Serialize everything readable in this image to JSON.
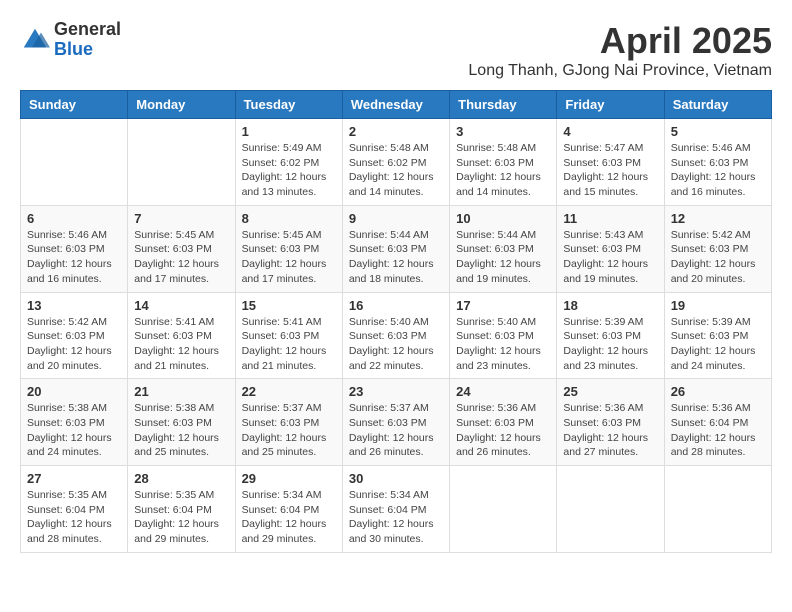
{
  "header": {
    "logo_general": "General",
    "logo_blue": "Blue",
    "month_title": "April 2025",
    "location": "Long Thanh, GJong Nai Province, Vietnam"
  },
  "weekdays": [
    "Sunday",
    "Monday",
    "Tuesday",
    "Wednesday",
    "Thursday",
    "Friday",
    "Saturday"
  ],
  "weeks": [
    [
      {
        "day": "",
        "info": ""
      },
      {
        "day": "",
        "info": ""
      },
      {
        "day": "1",
        "info": "Sunrise: 5:49 AM\nSunset: 6:02 PM\nDaylight: 12 hours and 13 minutes."
      },
      {
        "day": "2",
        "info": "Sunrise: 5:48 AM\nSunset: 6:02 PM\nDaylight: 12 hours and 14 minutes."
      },
      {
        "day": "3",
        "info": "Sunrise: 5:48 AM\nSunset: 6:03 PM\nDaylight: 12 hours and 14 minutes."
      },
      {
        "day": "4",
        "info": "Sunrise: 5:47 AM\nSunset: 6:03 PM\nDaylight: 12 hours and 15 minutes."
      },
      {
        "day": "5",
        "info": "Sunrise: 5:46 AM\nSunset: 6:03 PM\nDaylight: 12 hours and 16 minutes."
      }
    ],
    [
      {
        "day": "6",
        "info": "Sunrise: 5:46 AM\nSunset: 6:03 PM\nDaylight: 12 hours and 16 minutes."
      },
      {
        "day": "7",
        "info": "Sunrise: 5:45 AM\nSunset: 6:03 PM\nDaylight: 12 hours and 17 minutes."
      },
      {
        "day": "8",
        "info": "Sunrise: 5:45 AM\nSunset: 6:03 PM\nDaylight: 12 hours and 17 minutes."
      },
      {
        "day": "9",
        "info": "Sunrise: 5:44 AM\nSunset: 6:03 PM\nDaylight: 12 hours and 18 minutes."
      },
      {
        "day": "10",
        "info": "Sunrise: 5:44 AM\nSunset: 6:03 PM\nDaylight: 12 hours and 19 minutes."
      },
      {
        "day": "11",
        "info": "Sunrise: 5:43 AM\nSunset: 6:03 PM\nDaylight: 12 hours and 19 minutes."
      },
      {
        "day": "12",
        "info": "Sunrise: 5:42 AM\nSunset: 6:03 PM\nDaylight: 12 hours and 20 minutes."
      }
    ],
    [
      {
        "day": "13",
        "info": "Sunrise: 5:42 AM\nSunset: 6:03 PM\nDaylight: 12 hours and 20 minutes."
      },
      {
        "day": "14",
        "info": "Sunrise: 5:41 AM\nSunset: 6:03 PM\nDaylight: 12 hours and 21 minutes."
      },
      {
        "day": "15",
        "info": "Sunrise: 5:41 AM\nSunset: 6:03 PM\nDaylight: 12 hours and 21 minutes."
      },
      {
        "day": "16",
        "info": "Sunrise: 5:40 AM\nSunset: 6:03 PM\nDaylight: 12 hours and 22 minutes."
      },
      {
        "day": "17",
        "info": "Sunrise: 5:40 AM\nSunset: 6:03 PM\nDaylight: 12 hours and 23 minutes."
      },
      {
        "day": "18",
        "info": "Sunrise: 5:39 AM\nSunset: 6:03 PM\nDaylight: 12 hours and 23 minutes."
      },
      {
        "day": "19",
        "info": "Sunrise: 5:39 AM\nSunset: 6:03 PM\nDaylight: 12 hours and 24 minutes."
      }
    ],
    [
      {
        "day": "20",
        "info": "Sunrise: 5:38 AM\nSunset: 6:03 PM\nDaylight: 12 hours and 24 minutes."
      },
      {
        "day": "21",
        "info": "Sunrise: 5:38 AM\nSunset: 6:03 PM\nDaylight: 12 hours and 25 minutes."
      },
      {
        "day": "22",
        "info": "Sunrise: 5:37 AM\nSunset: 6:03 PM\nDaylight: 12 hours and 25 minutes."
      },
      {
        "day": "23",
        "info": "Sunrise: 5:37 AM\nSunset: 6:03 PM\nDaylight: 12 hours and 26 minutes."
      },
      {
        "day": "24",
        "info": "Sunrise: 5:36 AM\nSunset: 6:03 PM\nDaylight: 12 hours and 26 minutes."
      },
      {
        "day": "25",
        "info": "Sunrise: 5:36 AM\nSunset: 6:03 PM\nDaylight: 12 hours and 27 minutes."
      },
      {
        "day": "26",
        "info": "Sunrise: 5:36 AM\nSunset: 6:04 PM\nDaylight: 12 hours and 28 minutes."
      }
    ],
    [
      {
        "day": "27",
        "info": "Sunrise: 5:35 AM\nSunset: 6:04 PM\nDaylight: 12 hours and 28 minutes."
      },
      {
        "day": "28",
        "info": "Sunrise: 5:35 AM\nSunset: 6:04 PM\nDaylight: 12 hours and 29 minutes."
      },
      {
        "day": "29",
        "info": "Sunrise: 5:34 AM\nSunset: 6:04 PM\nDaylight: 12 hours and 29 minutes."
      },
      {
        "day": "30",
        "info": "Sunrise: 5:34 AM\nSunset: 6:04 PM\nDaylight: 12 hours and 30 minutes."
      },
      {
        "day": "",
        "info": ""
      },
      {
        "day": "",
        "info": ""
      },
      {
        "day": "",
        "info": ""
      }
    ]
  ]
}
